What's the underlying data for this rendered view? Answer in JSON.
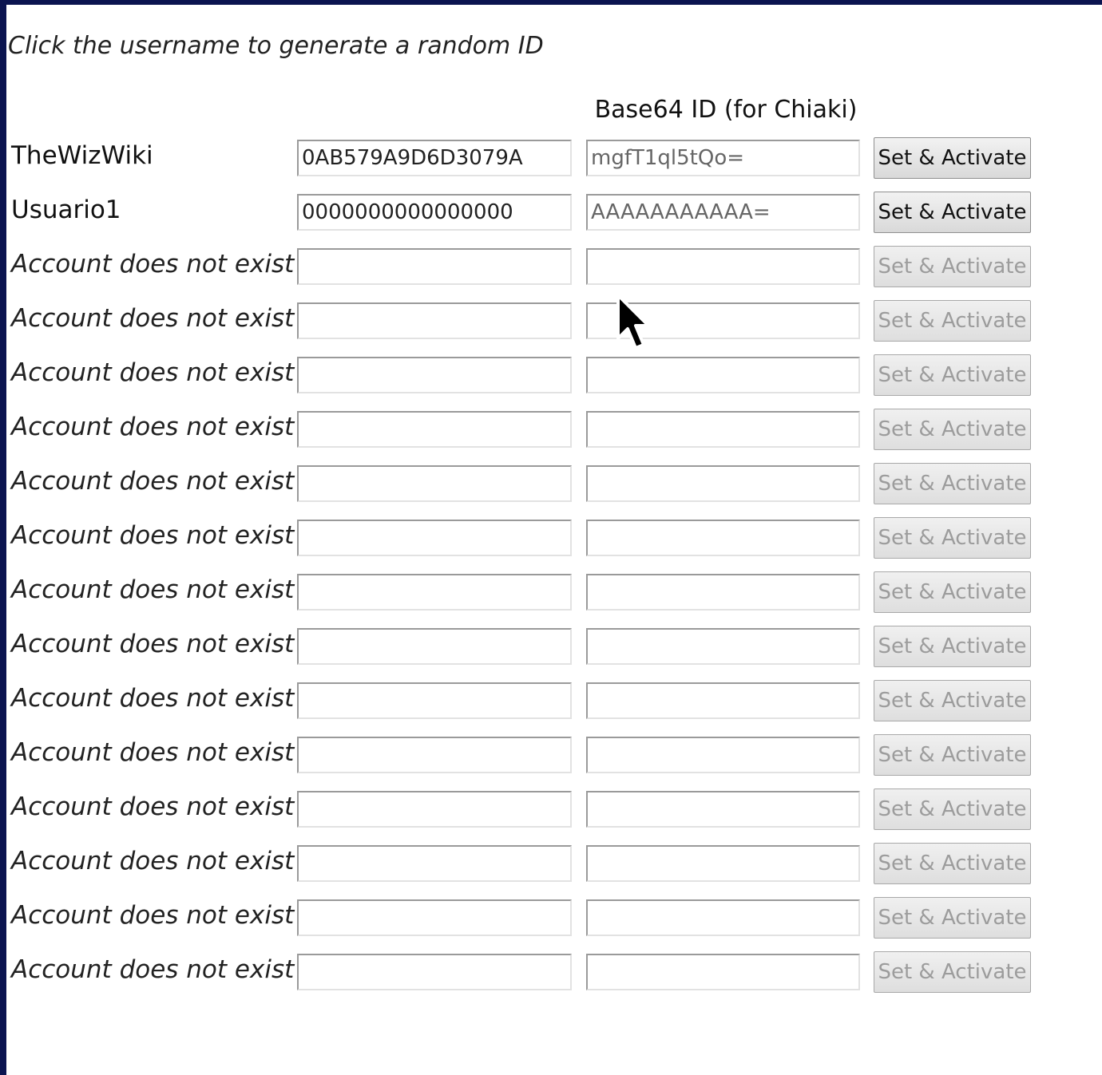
{
  "hint": "Click the username to generate a random ID",
  "base64_header": "Base64 ID (for Chiaki)",
  "button_label": "Set & Activate",
  "icons": {
    "cursor": "mouse-pointer-icon"
  },
  "accounts": [
    {
      "username": "TheWizWiki",
      "hex_id": "0AB579A9D6D3079A",
      "base64_id": "mgfT1ql5tQo=",
      "exists": true
    },
    {
      "username": "Usuario1",
      "hex_id": "0000000000000000",
      "base64_id": "AAAAAAAAAAA=",
      "exists": true
    },
    {
      "username": "Account does not exist",
      "hex_id": "",
      "base64_id": "",
      "exists": false
    },
    {
      "username": "Account does not exist",
      "hex_id": "",
      "base64_id": "",
      "exists": false
    },
    {
      "username": "Account does not exist",
      "hex_id": "",
      "base64_id": "",
      "exists": false
    },
    {
      "username": "Account does not exist",
      "hex_id": "",
      "base64_id": "",
      "exists": false
    },
    {
      "username": "Account does not exist",
      "hex_id": "",
      "base64_id": "",
      "exists": false
    },
    {
      "username": "Account does not exist",
      "hex_id": "",
      "base64_id": "",
      "exists": false
    },
    {
      "username": "Account does not exist",
      "hex_id": "",
      "base64_id": "",
      "exists": false
    },
    {
      "username": "Account does not exist",
      "hex_id": "",
      "base64_id": "",
      "exists": false
    },
    {
      "username": "Account does not exist",
      "hex_id": "",
      "base64_id": "",
      "exists": false
    },
    {
      "username": "Account does not exist",
      "hex_id": "",
      "base64_id": "",
      "exists": false
    },
    {
      "username": "Account does not exist",
      "hex_id": "",
      "base64_id": "",
      "exists": false
    },
    {
      "username": "Account does not exist",
      "hex_id": "",
      "base64_id": "",
      "exists": false
    },
    {
      "username": "Account does not exist",
      "hex_id": "",
      "base64_id": "",
      "exists": false
    },
    {
      "username": "Account does not exist",
      "hex_id": "",
      "base64_id": "",
      "exists": false
    }
  ]
}
